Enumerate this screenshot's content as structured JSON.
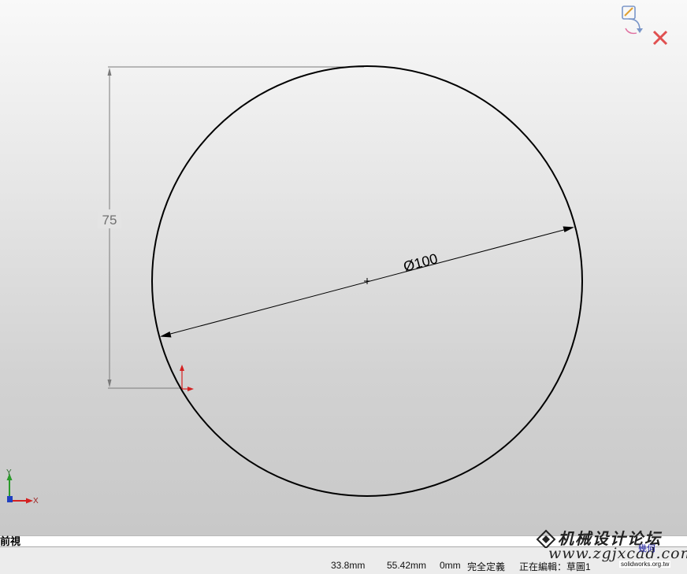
{
  "sketch": {
    "diameter_label": "Ø100",
    "vertical_dim_label": "75",
    "triad_x": "X",
    "triad_y": "Y"
  },
  "view": {
    "label": "前視"
  },
  "status_bar": {
    "x_coord": "33.8mm",
    "y_coord": "55.42mm",
    "z_coord": "0mm",
    "definition": "完全定義",
    "editing": "正在編輯：草圖1"
  },
  "confirm_corner": {
    "exit_icon": "sketch-exit-icon",
    "cancel_icon": "close-icon"
  },
  "watermark": {
    "title": "机械设计论坛",
    "url": "www.zgjxcad.com",
    "badge": "幾何",
    "small": "solidworks.org.tw"
  },
  "colors": {
    "sketch_line": "#000000",
    "dimension_line": "#707070",
    "cancel_red": "#e05050",
    "origin_red": "#d42020"
  }
}
